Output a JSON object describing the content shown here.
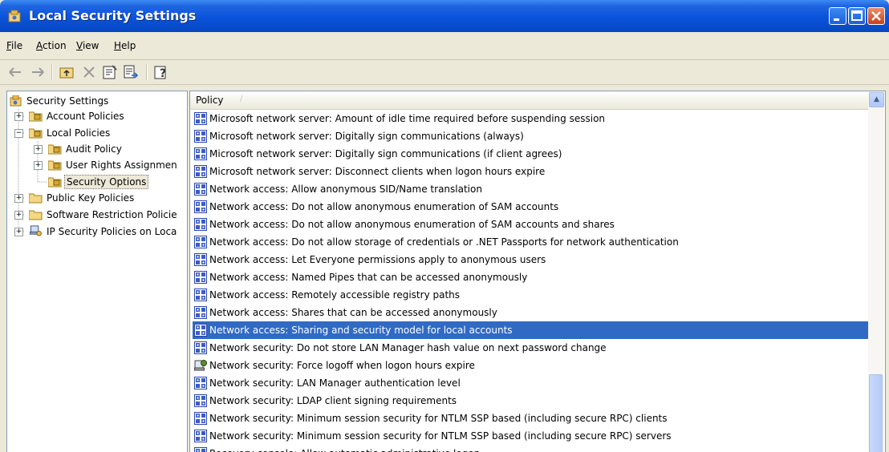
{
  "window": {
    "title": "Local Security Settings"
  },
  "menu": {
    "file": "File",
    "action": "Action",
    "view": "View",
    "help": "Help"
  },
  "toolbar": {
    "icons": [
      "back-arrow-icon",
      "forward-arrow-icon",
      "up-folder-icon",
      "delete-icon",
      "properties-icon",
      "export-list-icon",
      "help-icon"
    ]
  },
  "tree": {
    "root": "Security Settings",
    "account_policies": "Account Policies",
    "local_policies": "Local Policies",
    "audit_policy": "Audit Policy",
    "user_rights": "User Rights Assignmen",
    "security_options": "Security Options",
    "public_key": "Public Key Policies",
    "software_restriction": "Software Restriction Policie",
    "ip_security": "IP Security Policies on Loca"
  },
  "list": {
    "column_header": "Policy",
    "selected_index": 12,
    "rows": [
      "Microsoft network server: Amount of idle time required before suspending session",
      "Microsoft network server: Digitally sign communications (always)",
      "Microsoft network server: Digitally sign communications (if client agrees)",
      "Microsoft network server: Disconnect clients when logon hours expire",
      "Network access: Allow anonymous SID/Name translation",
      "Network access: Do not allow anonymous enumeration of SAM accounts",
      "Network access: Do not allow anonymous enumeration of SAM accounts and shares",
      "Network access: Do not allow storage of credentials or .NET Passports for network authentication",
      "Network access: Let Everyone permissions apply to anonymous users",
      "Network access: Named Pipes that can be accessed anonymously",
      "Network access: Remotely accessible registry paths",
      "Network access: Shares that can be accessed anonymously",
      "Network access: Sharing and security model for local accounts",
      "Network security: Do not store LAN Manager hash value on next password change",
      "Network security: Force logoff when logon hours expire",
      "Network security: LAN Manager authentication level",
      "Network security: LDAP client signing requirements",
      "Network security: Minimum session security for NTLM SSP based (including secure RPC) clients",
      "Network security: Minimum session security for NTLM SSP based (including secure RPC) servers",
      "Recovery console: Allow automatic administrative logon"
    ]
  },
  "colors": {
    "title_bar": "#0A53DB",
    "selection": "#316AC5",
    "chrome": "#ECE9D8"
  }
}
